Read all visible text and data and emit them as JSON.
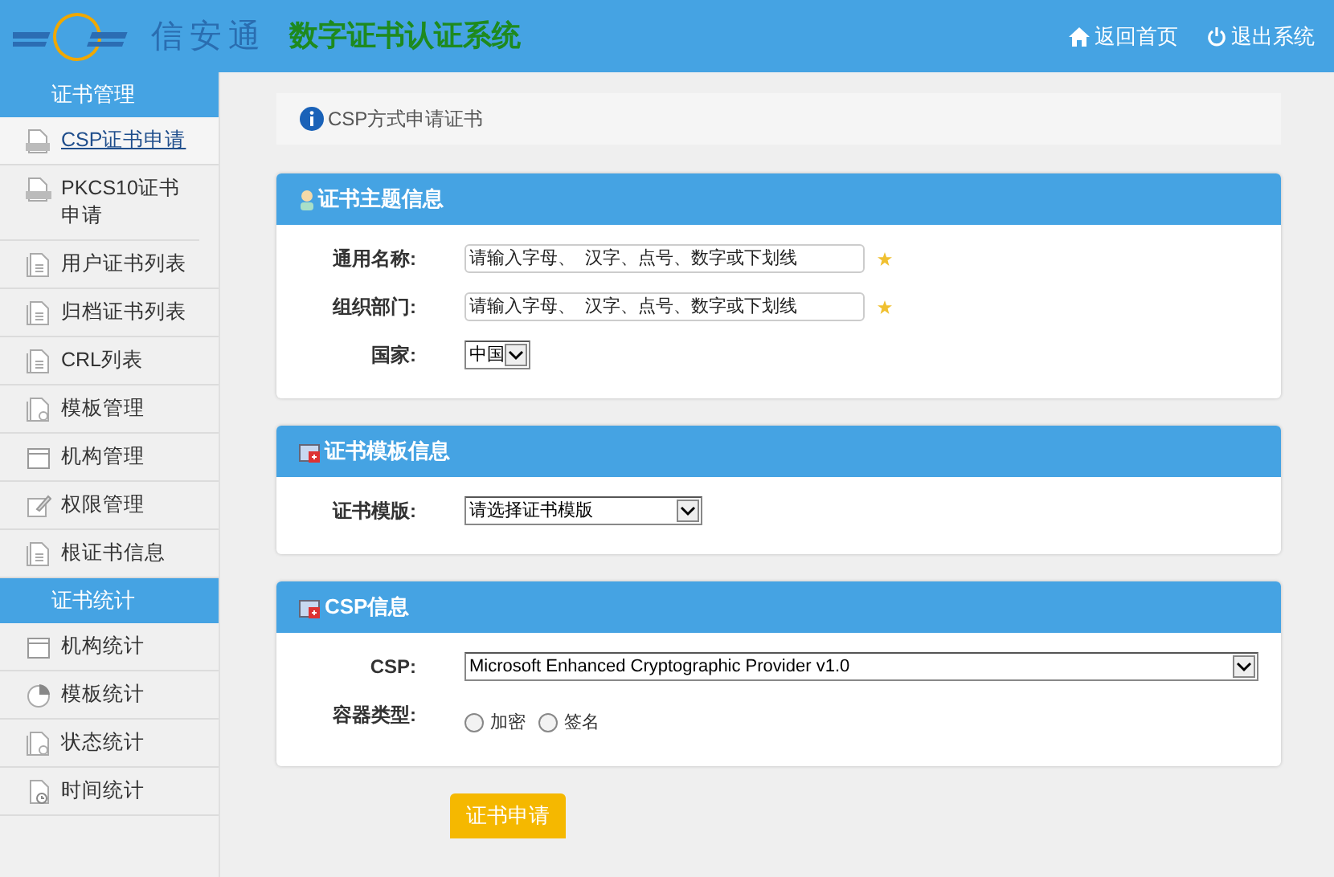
{
  "header": {
    "brand": "信安通",
    "title": "数字证书认证系统",
    "links": [
      {
        "kind": "home",
        "label": "返回首页"
      },
      {
        "kind": "power",
        "label": "退出系统"
      }
    ]
  },
  "sidebar": [
    {
      "title": "证书管理",
      "items": [
        {
          "kind": "csp",
          "label": "CSP证书申请",
          "selected": true
        },
        {
          "kind": "pkcs",
          "label": "PKCS10证书申请",
          "selected": false
        },
        {
          "kind": "doc",
          "label": "用户证书列表",
          "selected": false
        },
        {
          "kind": "doc",
          "label": "归档证书列表",
          "selected": false
        },
        {
          "kind": "doc",
          "label": "CRL列表",
          "selected": false
        },
        {
          "kind": "gear",
          "label": "模板管理",
          "selected": false
        },
        {
          "kind": "window",
          "label": "机构管理",
          "selected": false
        },
        {
          "kind": "edit",
          "label": "权限管理",
          "selected": false
        },
        {
          "kind": "doc",
          "label": "根证书信息",
          "selected": false
        }
      ]
    },
    {
      "title": "证书统计",
      "items": [
        {
          "kind": "window",
          "label": "机构统计",
          "selected": false
        },
        {
          "kind": "pie",
          "label": "模板统计",
          "selected": false
        },
        {
          "kind": "gear",
          "label": "状态统计",
          "selected": false
        },
        {
          "kind": "clock",
          "label": "时间统计",
          "selected": false
        }
      ]
    }
  ],
  "breadcrumb": "CSP方式申请证书",
  "panels": [
    {
      "kind": "person",
      "title": "证书主题信息",
      "fields": [
        {
          "kind": "text",
          "label": "通用名称:",
          "placeholder": "请输入字母、  汉字、点号、数字或下划线",
          "required": true
        },
        {
          "kind": "text",
          "label": "组织部门:",
          "placeholder": "请输入字母、  汉字、点号、数字或下划线",
          "required": true
        },
        {
          "kind": "select_small",
          "label": "国家:",
          "value": "中国"
        }
      ]
    },
    {
      "kind": "cert",
      "title": "证书模板信息",
      "fields": [
        {
          "kind": "select",
          "label": "证书模版:",
          "value": "请选择证书模版"
        }
      ]
    },
    {
      "kind": "cert",
      "title": "CSP信息",
      "fields": [
        {
          "kind": "select_wide",
          "label": "CSP:",
          "value": "Microsoft Enhanced Cryptographic Provider v1.0"
        },
        {
          "kind": "radios",
          "label": "容器类型:",
          "options": [
            {
              "label": "加密",
              "selected": false
            },
            {
              "label": "签名",
              "selected": false
            }
          ]
        }
      ]
    }
  ],
  "submit": "证书申请"
}
